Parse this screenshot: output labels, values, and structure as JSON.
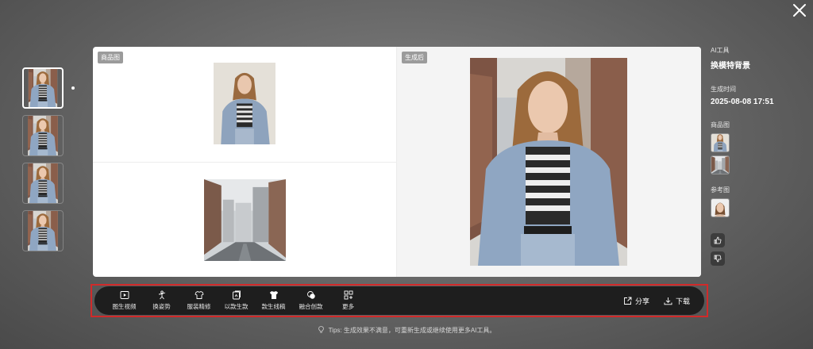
{
  "left_pane": {
    "product_tag": "商品图"
  },
  "right_pane": {
    "result_tag": "生成后"
  },
  "info": {
    "tool_label": "AI工具",
    "tool_name": "换模特背景",
    "time_label": "生成时间",
    "time_value": "2025-08-08 17:51",
    "product_label": "商品图",
    "reference_label": "参考图"
  },
  "toolbar": {
    "tools": [
      {
        "label": "图生视频",
        "icon": "video-play-icon"
      },
      {
        "label": "换姿势",
        "icon": "pose-icon"
      },
      {
        "label": "服装精修",
        "icon": "clothing-refine-icon"
      },
      {
        "label": "以款生款",
        "icon": "style-generate-icon"
      },
      {
        "label": "款生线稿",
        "icon": "line-draft-icon"
      },
      {
        "label": "融合创款",
        "icon": "fusion-icon"
      },
      {
        "label": "更多",
        "icon": "more-grid-icon"
      }
    ],
    "share_label": "分享",
    "download_label": "下载"
  },
  "tips": "Tips: 生成效果不满意，可重新生成或继续使用更多AI工具。",
  "colors": {
    "toolbar_bg": "#1e1e1e",
    "highlight_border": "#d12a2a",
    "tag_bg": "#9b9b9b"
  }
}
